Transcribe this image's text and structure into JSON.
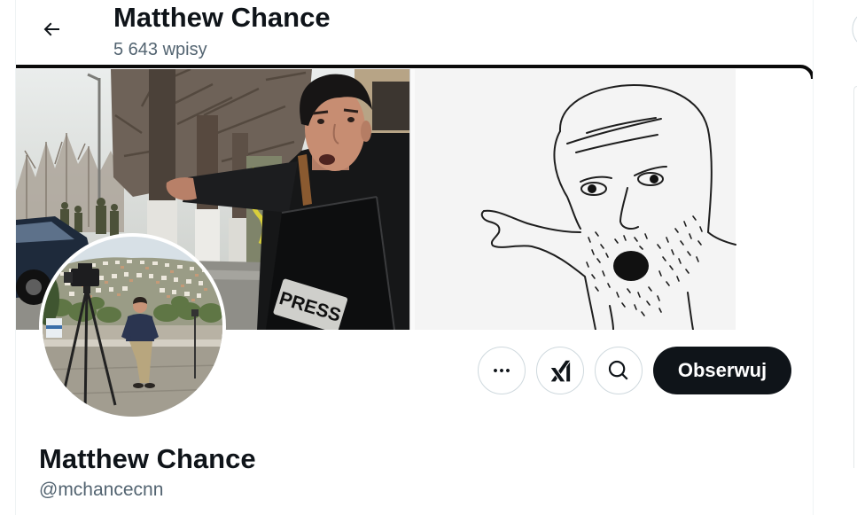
{
  "header": {
    "title": "Matthew Chance",
    "post_count": "5 643 wpisy"
  },
  "banner": {
    "press_text": "PRESS"
  },
  "profile": {
    "name": "Matthew Chance",
    "handle": "@mchancecnn"
  },
  "actions": {
    "follow_label": "Obserwuj"
  },
  "icons": {
    "back": "arrow-left-icon",
    "more": "more-icon",
    "grok": "grok-icon",
    "search": "search-icon"
  },
  "colors": {
    "text_primary": "#0f1419",
    "text_secondary": "#536471",
    "border": "#eff3f4",
    "button_border": "#cfd9de",
    "follow_button_bg": "#0f1419",
    "follow_button_text": "#ffffff"
  }
}
